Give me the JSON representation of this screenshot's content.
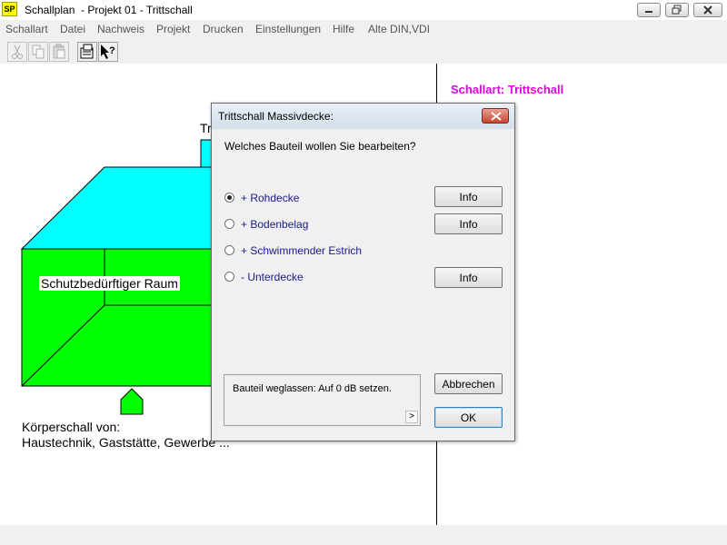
{
  "window": {
    "app_icon_text": "SP",
    "title": "Schallplan  - Projekt 01 - Trittschall"
  },
  "menu": {
    "items": [
      "Schallart",
      "Datei",
      "Nachweis",
      "Projekt",
      "Drucken",
      "Einstellungen",
      "Hilfe",
      "Alte DIN,VDI"
    ]
  },
  "toolbar": {
    "buttons": [
      "cut-icon",
      "copy-icon",
      "paste-icon",
      "properties-icon",
      "help-pointer-icon"
    ]
  },
  "canvas": {
    "schallart_label": "Schallart: Trittschall",
    "room_label": "Schutzbedürftiger Raum",
    "top_label_partial": "Tr",
    "koerper_line1": "Körperschall von:",
    "koerper_line2": "Haustechnik, Gaststätte, Gewerbe ...",
    "colors": {
      "roof": "#00ffff",
      "room": "#00ff00",
      "schallart": "#e000e0"
    }
  },
  "dialog": {
    "title": "Trittschall Massivdecke:",
    "question": "Welches Bauteil wollen Sie bearbeiten?",
    "options": [
      {
        "label": "+ Rohdecke",
        "checked": true,
        "info": "Info"
      },
      {
        "label": "+ Bodenbelag",
        "checked": false,
        "info": "Info"
      },
      {
        "label": "+ Schwimmender Estrich",
        "checked": false,
        "info": ""
      },
      {
        "label": "- Unterdecke",
        "checked": false,
        "info": "Info"
      }
    ],
    "hint": "Bauteil weglassen: Auf 0 dB setzen.",
    "cancel_label": "Abbrechen",
    "ok_label": "OK"
  }
}
